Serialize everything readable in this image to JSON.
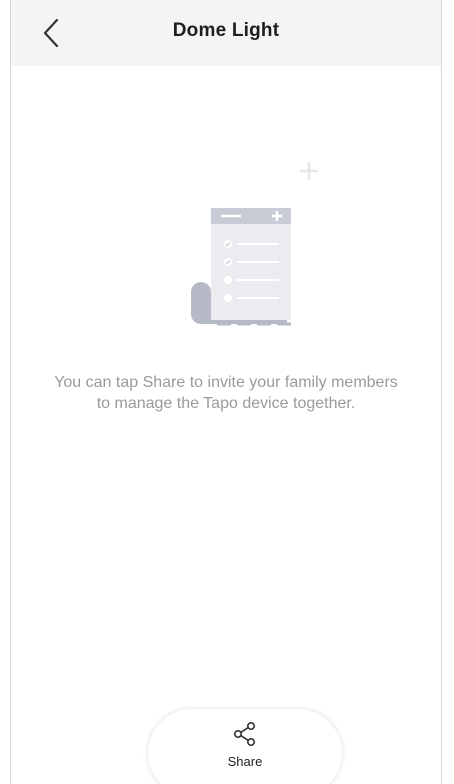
{
  "header": {
    "title": "Dome Light",
    "back_icon": "chevron-left-icon"
  },
  "empty_state": {
    "illustration": "document-list-icon",
    "message": "You can tap Share to invite your family members to manage the Tapo device together."
  },
  "share": {
    "icon": "share-icon",
    "label": "Share"
  },
  "colors": {
    "nav_bg": "#f4f4f4",
    "text_muted": "#9a9a9a",
    "title_text": "#1e1e1e"
  }
}
